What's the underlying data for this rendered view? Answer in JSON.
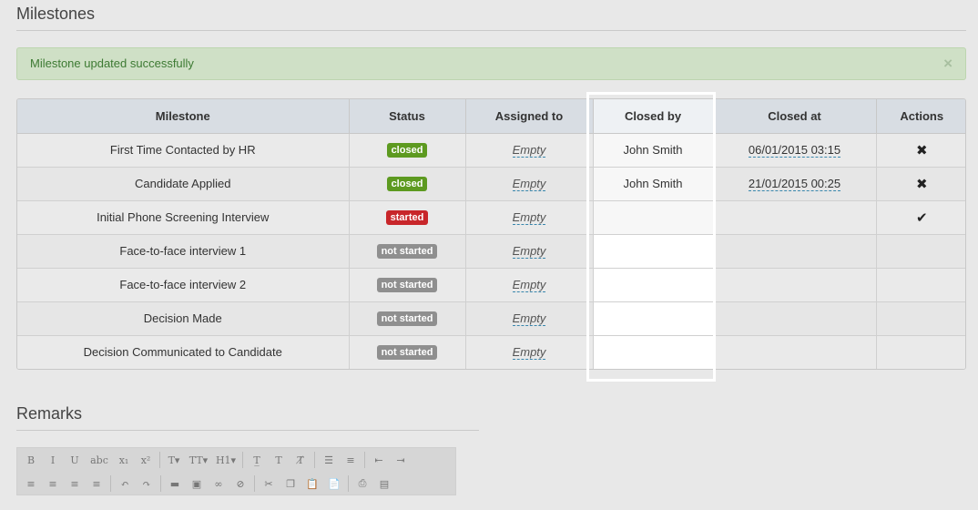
{
  "milestones_section": {
    "title": "Milestones"
  },
  "alert": {
    "message": "Milestone updated successfully",
    "close": "×"
  },
  "table": {
    "headers": [
      "Milestone",
      "Status",
      "Assigned to",
      "Closed by",
      "Closed at",
      "Actions"
    ],
    "rows": [
      {
        "milestone": "First Time Contacted by HR",
        "status": "closed",
        "status_type": "closed",
        "assigned": "Empty",
        "closed_by": "John Smith",
        "closed_at": "06/01/2015 03:15",
        "action": "✖",
        "action_name": "reopen-icon"
      },
      {
        "milestone": "Candidate Applied",
        "status": "closed",
        "status_type": "closed",
        "assigned": "Empty",
        "closed_by": "John Smith",
        "closed_at": "21/01/2015 00:25",
        "action": "✖",
        "action_name": "reopen-icon"
      },
      {
        "milestone": "Initial Phone Screening Interview",
        "status": "started",
        "status_type": "started",
        "assigned": "Empty",
        "closed_by": "",
        "closed_at": "",
        "action": "✔",
        "action_name": "complete-icon"
      },
      {
        "milestone": "Face-to-face interview 1",
        "status": "not started",
        "status_type": "not-started",
        "assigned": "Empty",
        "closed_by": "",
        "closed_at": "",
        "action": "",
        "action_name": ""
      },
      {
        "milestone": "Face-to-face interview 2",
        "status": "not started",
        "status_type": "not-started",
        "assigned": "Empty",
        "closed_by": "",
        "closed_at": "",
        "action": "",
        "action_name": ""
      },
      {
        "milestone": "Decision Made",
        "status": "not started",
        "status_type": "not-started",
        "assigned": "Empty",
        "closed_by": "",
        "closed_at": "",
        "action": "",
        "action_name": ""
      },
      {
        "milestone": "Decision Communicated to Candidate",
        "status": "not started",
        "status_type": "not-started",
        "assigned": "Empty",
        "closed_by": "",
        "closed_at": "",
        "action": "",
        "action_name": ""
      }
    ]
  },
  "remarks_section": {
    "title": "Remarks"
  },
  "editor_toolbar": {
    "row1": [
      {
        "name": "bold-icon",
        "glyph": "B"
      },
      {
        "name": "italic-icon",
        "glyph": "I"
      },
      {
        "name": "underline-icon",
        "glyph": "U"
      },
      {
        "name": "strikethrough-icon",
        "glyph": "abc"
      },
      {
        "name": "subscript-icon",
        "glyph": "x₁"
      },
      {
        "name": "superscript-icon",
        "glyph": "x²"
      },
      {
        "sep": true
      },
      {
        "name": "font-icon",
        "glyph": "T▾"
      },
      {
        "name": "font-size-icon",
        "glyph": "TT▾"
      },
      {
        "name": "heading-icon",
        "glyph": "H1▾"
      },
      {
        "sep": true
      },
      {
        "name": "text-background-icon",
        "glyph": "T̲"
      },
      {
        "name": "text-color-icon",
        "glyph": "T"
      },
      {
        "name": "clear-format-icon",
        "glyph": "T̸"
      },
      {
        "sep": true
      },
      {
        "name": "unordered-list-icon",
        "glyph": "☰"
      },
      {
        "name": "ordered-list-icon",
        "glyph": "≡"
      },
      {
        "sep": true
      },
      {
        "name": "outdent-icon",
        "glyph": "⇤"
      },
      {
        "name": "indent-icon",
        "glyph": "⇥"
      }
    ],
    "row2": [
      {
        "name": "align-left-icon",
        "glyph": "≡"
      },
      {
        "name": "align-center-icon",
        "glyph": "≡"
      },
      {
        "name": "align-right-icon",
        "glyph": "≡"
      },
      {
        "name": "justify-icon",
        "glyph": "≡"
      },
      {
        "sep": true
      },
      {
        "name": "undo-icon",
        "glyph": "↶"
      },
      {
        "name": "redo-icon",
        "glyph": "↷"
      },
      {
        "sep": true
      },
      {
        "name": "horizontal-rule-icon",
        "glyph": "▬"
      },
      {
        "name": "image-icon",
        "glyph": "▣"
      },
      {
        "name": "link-icon",
        "glyph": "∞"
      },
      {
        "name": "unlink-icon",
        "glyph": "⊘"
      },
      {
        "sep": true
      },
      {
        "name": "cut-icon",
        "glyph": "✂"
      },
      {
        "name": "copy-icon",
        "glyph": "❐"
      },
      {
        "name": "paste-icon",
        "glyph": "📋"
      },
      {
        "name": "paste-text-icon",
        "glyph": "📄"
      },
      {
        "sep": true
      },
      {
        "name": "print-icon",
        "glyph": "⎙"
      },
      {
        "name": "source-icon",
        "glyph": "▤"
      }
    ]
  }
}
